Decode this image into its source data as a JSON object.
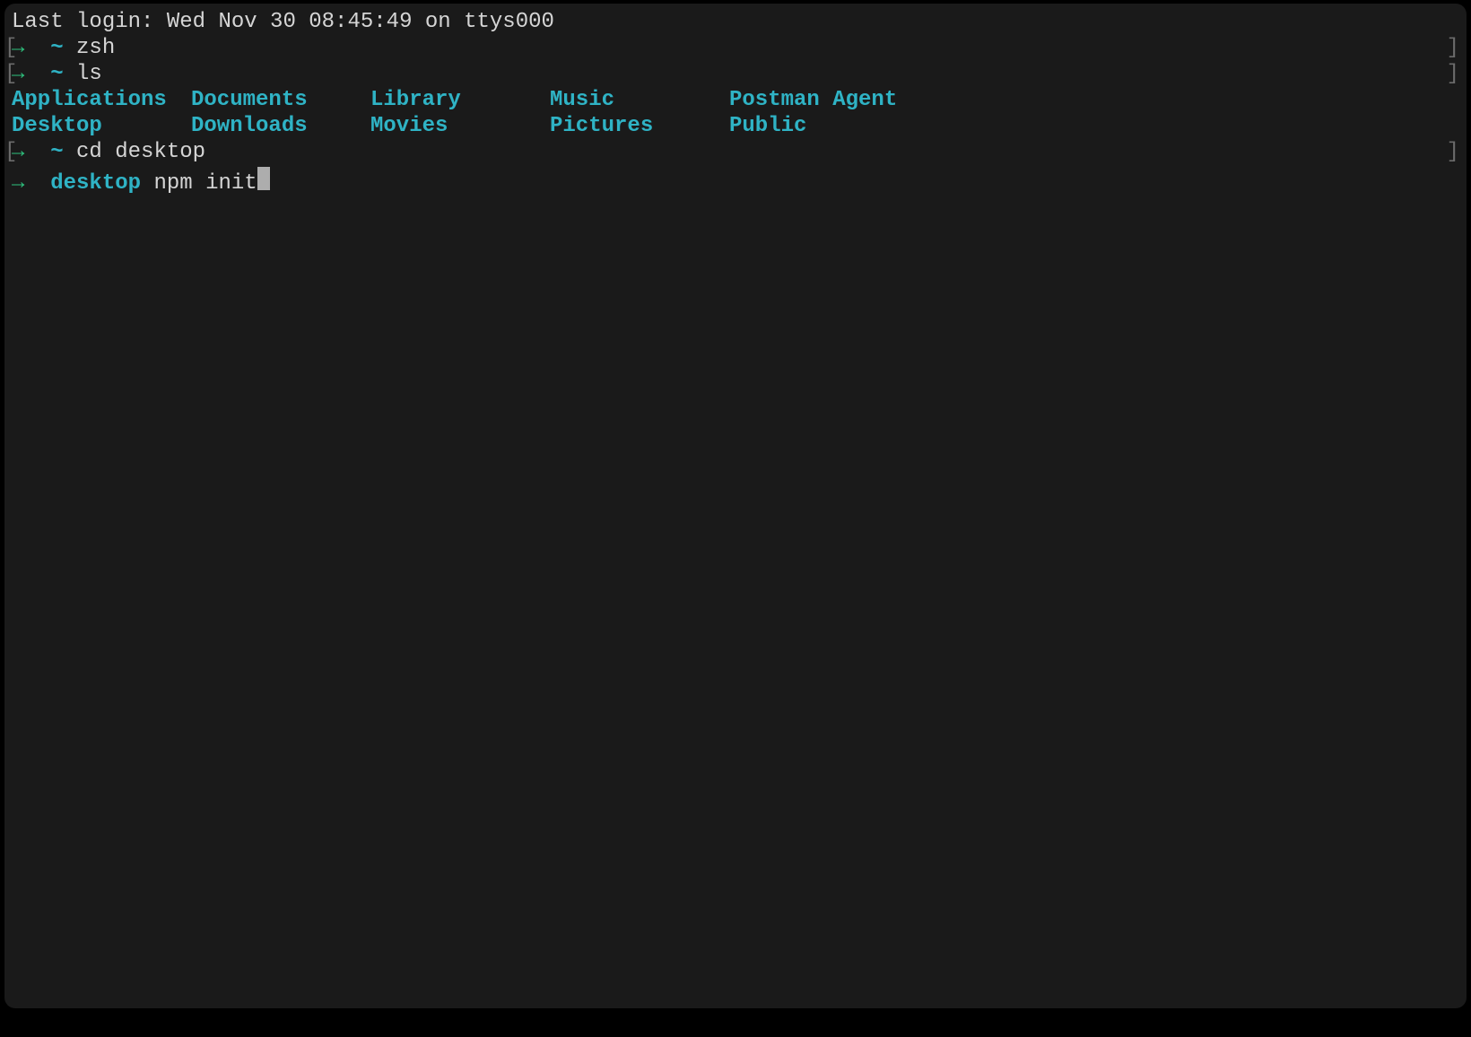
{
  "last_login": "Last login: Wed Nov 30 08:45:49 on ttys000",
  "prompts": {
    "arrow": "→",
    "home": "~",
    "desktop_path": "desktop",
    "lbracket": "[",
    "rbracket": "]"
  },
  "commands": {
    "zsh": "zsh",
    "ls": "ls",
    "cd_desktop": "cd desktop",
    "npm_init": "npm init"
  },
  "ls_output": {
    "row1": [
      "Applications",
      "Documents",
      "Library",
      "Music",
      "Postman Agent"
    ],
    "row2": [
      "Desktop",
      "Downloads",
      "Movies",
      "Pictures",
      "Public"
    ]
  },
  "colors": {
    "background": "#1a1a1a",
    "text": "#d5d5d5",
    "arrow_green": "#2ec27e",
    "dir_teal": "#2fb3c5",
    "bracket_gray": "#6b6b6b"
  }
}
